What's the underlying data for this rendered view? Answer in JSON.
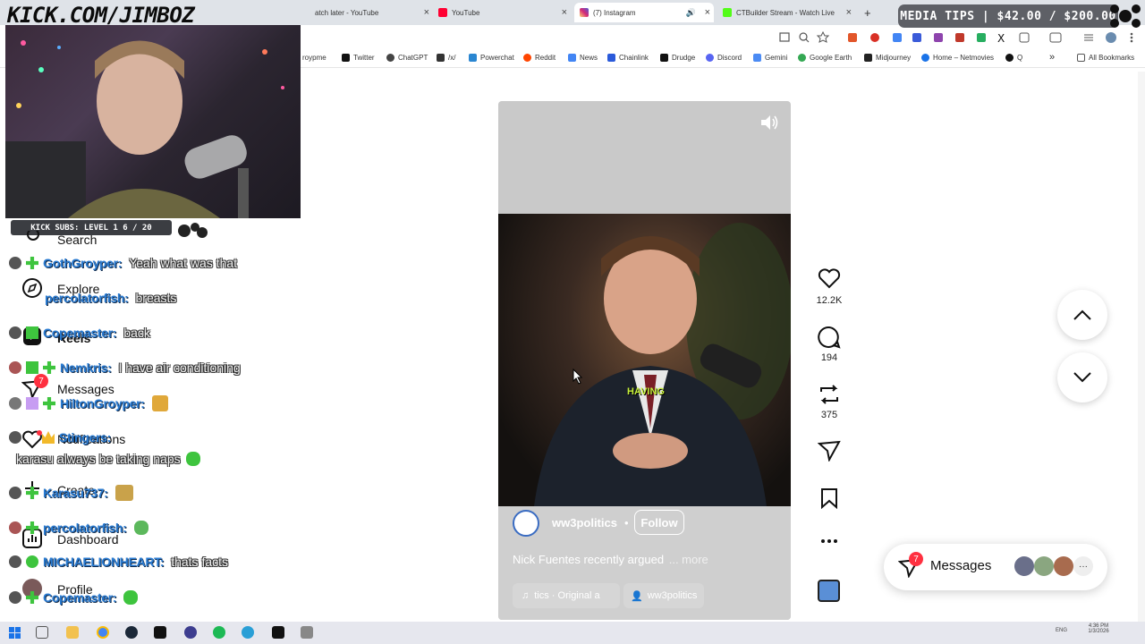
{
  "browser": {
    "tabs": [
      {
        "label": "atch later - YouTube",
        "color": "#e0e0e0"
      },
      {
        "label": "YouTube",
        "color": "#ff0033"
      },
      {
        "label": "(7) Instagram",
        "color": "#d6249f"
      },
      {
        "label": "CTBuilder Stream - Watch Live",
        "color": "#53fc18"
      }
    ],
    "new_tab_label": "+",
    "close_glyph": "×",
    "bookmarks": [
      {
        "label": "roypme",
        "icon": "site-icon"
      },
      {
        "label": "Twitter",
        "icon": "x-icon"
      },
      {
        "label": "ChatGPT",
        "icon": "chatgpt-icon"
      },
      {
        "label": "/x/",
        "icon": "grid-icon"
      },
      {
        "label": "Powerchat",
        "icon": "powerchat-icon"
      },
      {
        "label": "Reddit",
        "icon": "reddit-icon"
      },
      {
        "label": "News",
        "icon": "news-icon"
      },
      {
        "label": "Chainlink",
        "icon": "chainlink-icon"
      },
      {
        "label": "Drudge",
        "icon": "drudge-icon"
      },
      {
        "label": "Discord",
        "icon": "discord-icon"
      },
      {
        "label": "Gemini",
        "icon": "gemini-icon"
      },
      {
        "label": "Google Earth",
        "icon": "earth-icon"
      },
      {
        "label": "Midjourney",
        "icon": "midjourney-icon"
      },
      {
        "label": "Home – Netmovies",
        "icon": "netmovies-icon"
      },
      {
        "label": "Q",
        "icon": "q-icon"
      }
    ],
    "more_bookmarks": "»",
    "all_bookmarks": "All Bookmarks"
  },
  "overlay": {
    "brand": "KICK.COM/JIMBOZ",
    "media_tips": "MEDIA TIPS | $42.00 / $200.00",
    "kick_subs": "KICK SUBS: LEVEL 1 6 / 20"
  },
  "instagram_nav": {
    "search": "Search",
    "explore": "Explore",
    "reels": "Reels",
    "messages": "Messages",
    "messages_badge": "7",
    "notifications": "Notifications",
    "create": "Create",
    "dashboard": "Dashboard",
    "profile": "Profile"
  },
  "chat": [
    {
      "user": "GothGroyper:",
      "msg": "Yeah what was that"
    },
    {
      "user": "percolatorfish:",
      "msg": "breasts"
    },
    {
      "user": "Copemaster:",
      "msg": "back"
    },
    {
      "user": "Nemkris:",
      "msg": "I have air conditioning"
    },
    {
      "user": "HiltonGroyper:",
      "msg": ""
    },
    {
      "user": "Stingers:",
      "msg": ""
    },
    {
      "user": "",
      "msg": "karasu always be taking naps"
    },
    {
      "user": "Karasu737:",
      "msg": ""
    },
    {
      "user": "percolatorfish:",
      "msg": ""
    },
    {
      "user": "MICHAELIONHEART:",
      "msg": "thats facts"
    },
    {
      "user": "Copemaster:",
      "msg": ""
    }
  ],
  "reel": {
    "caption_overlay": "HAVING",
    "account": "ww3politics",
    "separator": "•",
    "follow": "Follow",
    "description": "Nick Fuentes recently argued",
    "more": "... more",
    "audio": "tics · Original a",
    "tagged_account": "ww3politics",
    "likes": "12.2K",
    "comments": "194",
    "reposts": "375"
  },
  "messages_pill": {
    "label": "Messages",
    "badge": "7",
    "more": "···"
  },
  "taskbar": {
    "lang": "ENG",
    "time": "4:36 PM",
    "date": "1/3/2026"
  }
}
